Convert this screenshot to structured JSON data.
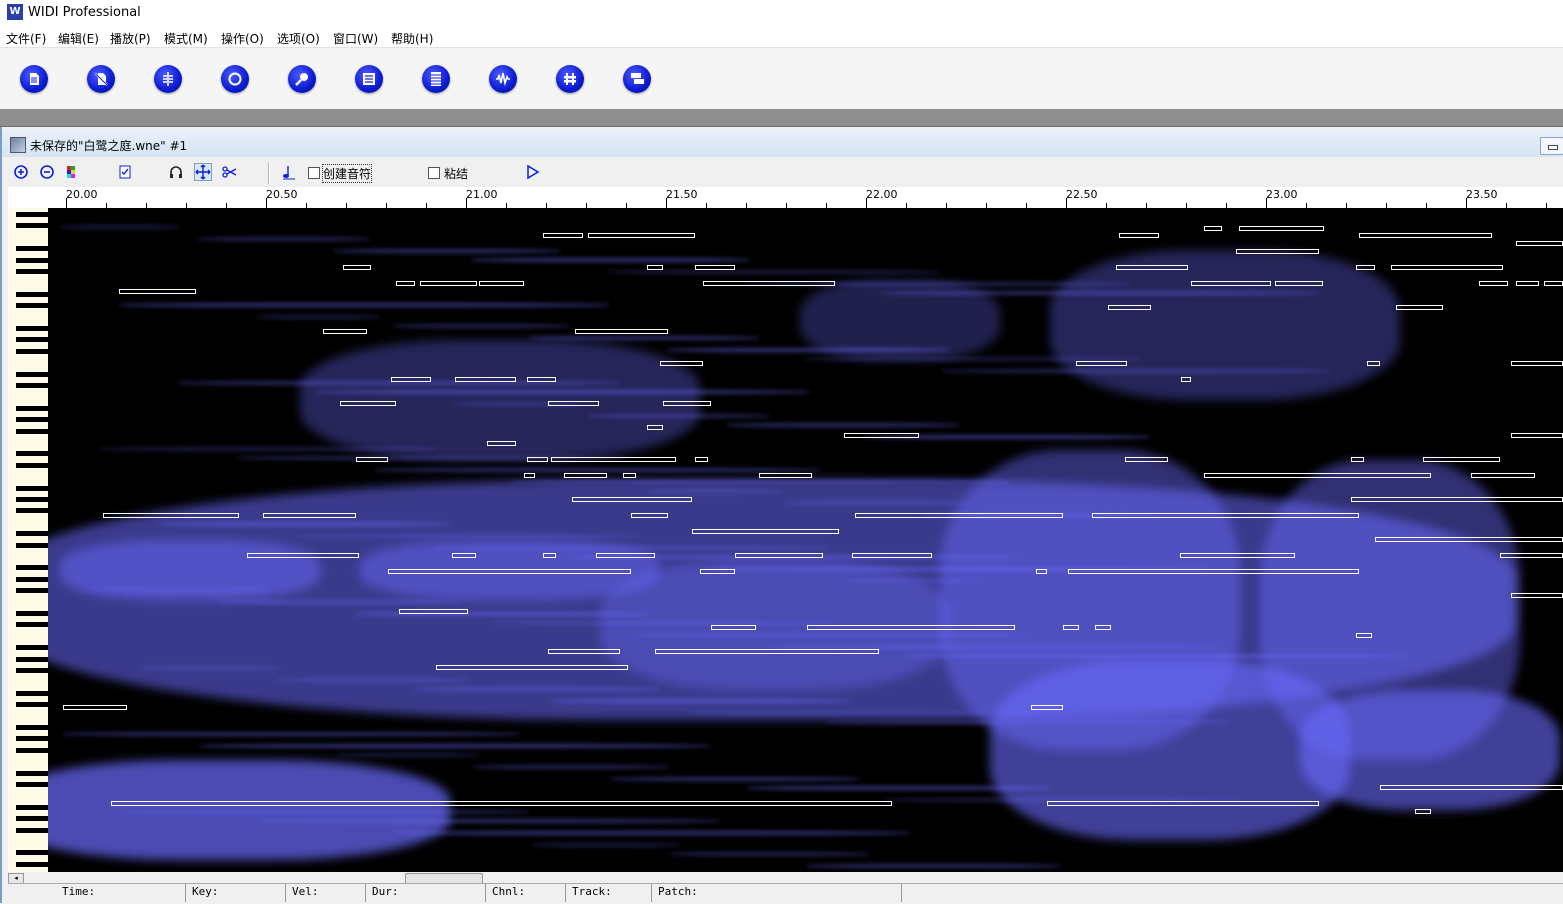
{
  "app": {
    "title": "WIDI Professional",
    "icon_label": "W"
  },
  "menu": [
    "文件(F)",
    "编辑(E)",
    "播放(P)",
    "模式(M)",
    "操作(O)",
    "选项(O)",
    "窗口(W)",
    "帮助(H)"
  ],
  "toolbar": {
    "buttons": [
      "document-icon",
      "no-edit-icon",
      "split-icon",
      "circle-icon",
      "magnifier-icon",
      "list-icon",
      "bars-icon",
      "waveform-icon",
      "mixer-icon",
      "stack-icon"
    ]
  },
  "document": {
    "title": "未保存的\"白鹭之庭.wne\" #1"
  },
  "subtoolbar": {
    "create_chord_label": "创建音符",
    "paste_label": "粘结"
  },
  "ruler": {
    "labels": [
      "20.00",
      "20.50",
      "21.00",
      "21.50",
      "22.00",
      "22.50",
      "23.00",
      "23.50"
    ]
  },
  "status": {
    "time_label": "Time:",
    "key_label": "Key:",
    "vel_label": "Vel:",
    "dur_label": "Dur:",
    "chnl_label": "Chnl:",
    "track_label": "Track:",
    "patch_label": "Patch:"
  },
  "colors": {
    "spectrum": "#6b6bff",
    "note_outline": "#ffffff",
    "accent": "#1020d8"
  }
}
